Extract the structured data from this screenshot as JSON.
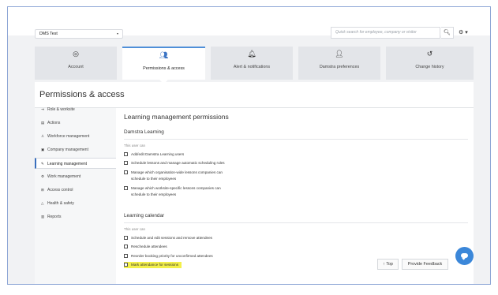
{
  "topbar": {
    "org_select": "DMS Test",
    "search_placeholder": "Quick search for employee, company or visitor",
    "search_icon": "search-icon",
    "settings_icon": "gear-icon"
  },
  "tabs": [
    {
      "label": "Account",
      "icon": "account-icon",
      "active": false
    },
    {
      "label": "Permissions & access",
      "icon": "people-icon",
      "active": true
    },
    {
      "label": "Alert & notifications",
      "icon": "bell-icon",
      "active": false
    },
    {
      "label": "Damstra preferences",
      "icon": "user-settings-icon",
      "active": false
    },
    {
      "label": "Change history",
      "icon": "history-icon",
      "active": false
    }
  ],
  "panel": {
    "title": "Permissions & access"
  },
  "sidebar": {
    "items": [
      {
        "label": "Role & worksite",
        "icon": "login-icon"
      },
      {
        "label": "Actions",
        "icon": "clipboard-icon"
      },
      {
        "label": "Workforce management",
        "icon": "person-icon"
      },
      {
        "label": "Company management",
        "icon": "briefcase-icon"
      },
      {
        "label": "Learning management",
        "icon": "learning-icon",
        "active": true
      },
      {
        "label": "Work management",
        "icon": "wrench-icon"
      },
      {
        "label": "Access control",
        "icon": "access-icon"
      },
      {
        "label": "Health & safety",
        "icon": "warning-icon"
      },
      {
        "label": "Reports",
        "icon": "chart-icon"
      }
    ]
  },
  "content": {
    "heading": "Learning management permissions",
    "section1": {
      "title": "Damstra Learning",
      "subtitle": "This user can",
      "options": [
        "Add/edit Damstra Learning users",
        "Schedule lessons and manage automatic scheduling rules",
        "Manage which organisation-wide lessons companies can",
        "schedule to their employees",
        "Manage which worksite-specific lessons companies can",
        "schedule to their employees"
      ]
    },
    "section2": {
      "title": "Learning calendar",
      "subtitle": "This user can",
      "options": [
        "Schedule and edit sessions and remove attendees",
        "Reschedule attendees",
        "Reorder booking priority for unconfirmed attendees",
        "Mark attendance for sessions"
      ]
    }
  },
  "footer": {
    "top_label": "Top",
    "feedback_label": "Provide Feedback",
    "highlight_color": "#f3f04a",
    "accent_color": "#3b87d9"
  }
}
